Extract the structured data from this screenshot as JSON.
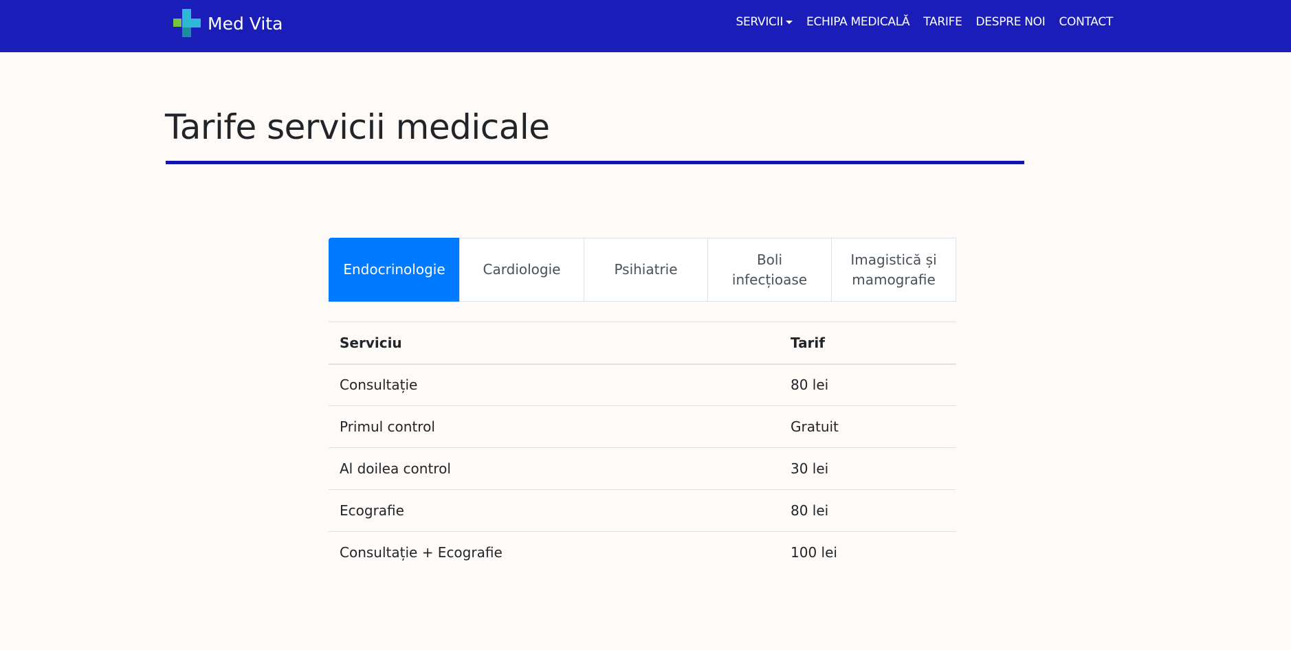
{
  "navbar": {
    "brand": "Med Vita",
    "links": [
      {
        "label": "SERVICII",
        "dropdown": true
      },
      {
        "label": "ECHIPA MEDICALĂ"
      },
      {
        "label": "TARIFE"
      },
      {
        "label": "DESPRE NOI"
      },
      {
        "label": "CONTACT"
      }
    ]
  },
  "page": {
    "title": "Tarife servicii medicale"
  },
  "tabs": {
    "active_index": 0,
    "items": [
      {
        "label": "Endocrinologie"
      },
      {
        "label": "Cardiologie"
      },
      {
        "label": "Psihiatrie"
      },
      {
        "label": "Boli infecțioase",
        "lines": [
          "Boli",
          "infecțioase"
        ]
      },
      {
        "label": "Imagistică și mamografie",
        "lines": [
          "Imagistică și",
          "mamografie"
        ]
      }
    ]
  },
  "table": {
    "headers": [
      "Serviciu",
      "Tarif"
    ],
    "rows": [
      [
        "Consultație",
        "80 lei"
      ],
      [
        "Primul control",
        "Gratuit"
      ],
      [
        "Al doilea control",
        "30 lei"
      ],
      [
        "Ecografie",
        "80 lei"
      ],
      [
        "Consultație + Ecografie",
        "100 lei"
      ]
    ]
  },
  "colors": {
    "navbar": "#1b1db8",
    "accent_rule": "#1114b3",
    "active_tab": "#007bff",
    "background": "#fefaf8",
    "logo_green": "#76c442",
    "logo_cyan": "#2fb7d6",
    "logo_teal": "#1c8f9b"
  }
}
